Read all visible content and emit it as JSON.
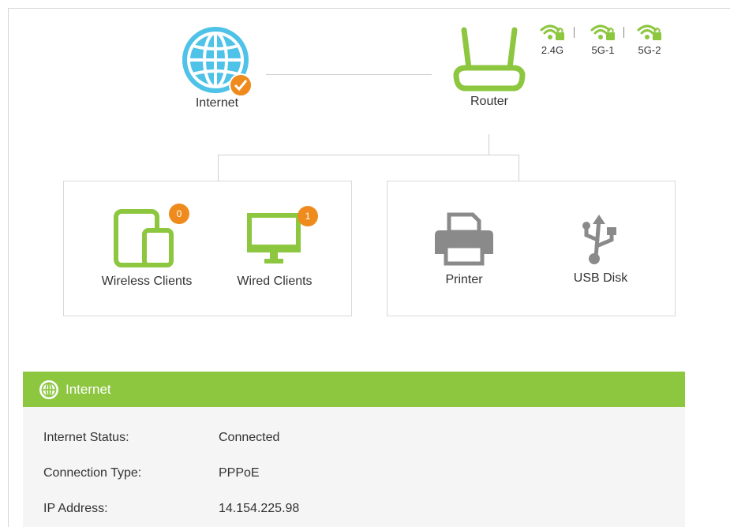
{
  "topology": {
    "internet_label": "Internet",
    "router_label": "Router"
  },
  "bands": [
    {
      "label": "2.4G"
    },
    {
      "label": "5G-1"
    },
    {
      "label": "5G-2"
    }
  ],
  "clients": {
    "wireless_label": "Wireless Clients",
    "wireless_count": "0",
    "wired_label": "Wired Clients",
    "wired_count": "1"
  },
  "peripherals": {
    "printer_label": "Printer",
    "usb_label": "USB Disk"
  },
  "internet_panel": {
    "title": "Internet",
    "rows": [
      {
        "key": "Internet Status:",
        "value": "Connected"
      },
      {
        "key": "Connection Type:",
        "value": "PPPoE"
      },
      {
        "key": "IP Address:",
        "value": "14.154.225.98"
      }
    ]
  },
  "colors": {
    "green": "#8dc63f",
    "globe_blue": "#4fc2e8",
    "orange": "#ef8a1d",
    "grey_icon": "#8a8a8a"
  }
}
